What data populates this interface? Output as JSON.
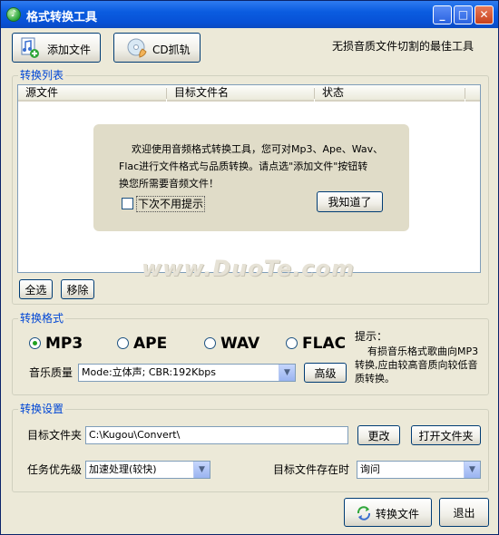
{
  "window": {
    "title": "格式转换工具",
    "controls": {
      "minimize": "_",
      "maximize": "□",
      "close": "✕"
    }
  },
  "toolbar": {
    "add_file": "添加文件",
    "cd_rip": "CD抓轨",
    "slogan": "无损音质文件切割的最佳工具"
  },
  "convert_list": {
    "title": "转换列表",
    "columns": [
      "源文件",
      "目标文件名",
      "状态"
    ],
    "select_all": "全选",
    "remove": "移除"
  },
  "welcome": {
    "line1": "欢迎使用音频格式转换工具，您可对Mp3、Ape、Wav、",
    "line2": "Flac进行文件格式与品质转换。请点选\"添加文件\"按钮转",
    "line3": "换您所需要音频文件！",
    "dont_show": "下次不用提示",
    "got_it": "我知道了"
  },
  "watermark": "www.DuoTe.com",
  "format": {
    "title": "转换格式",
    "options": [
      "MP3",
      "APE",
      "WAV",
      "FLAC"
    ],
    "selected": "MP3",
    "quality_label": "音乐质量",
    "quality_value": "Mode:立体声; CBR:192Kbps",
    "advanced": "高级",
    "hint_title": "提示：",
    "hint_text": "有损音乐格式歌曲向MP3转换,应由较高音质向较低音质转换。"
  },
  "settings": {
    "title": "转换设置",
    "target_folder_label": "目标文件夹",
    "target_folder_value": "C:\\Kugou\\Convert\\",
    "change": "更改",
    "open_folder": "打开文件夹",
    "priority_label": "任务优先级",
    "priority_value": "加速处理(较快)",
    "exists_label": "目标文件存在时",
    "exists_value": "询问"
  },
  "footer": {
    "convert": "转换文件",
    "exit": "退出"
  },
  "colors": {
    "accent": "#0046d5",
    "titlebar": "#0851d6",
    "window_bg": "#ece9d8",
    "radio_selected": "#21a121"
  }
}
